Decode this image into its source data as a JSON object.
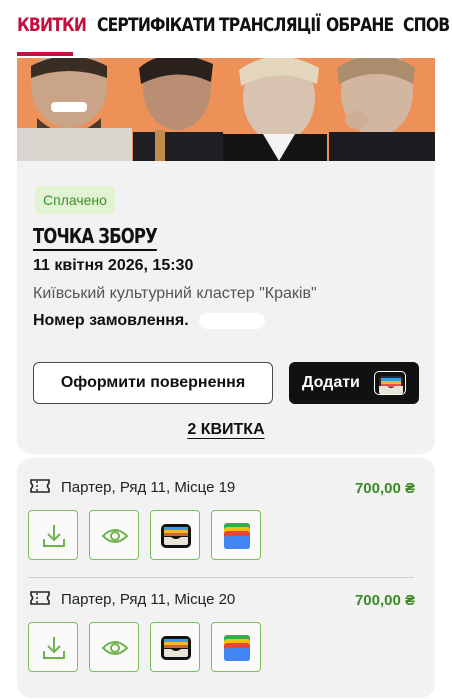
{
  "tabs": [
    {
      "label": "КВИТКИ"
    },
    {
      "label": "СЕРТИФІКАТИ"
    },
    {
      "label": "ТРАНСЛЯЦІЇ"
    },
    {
      "label": "ОБРАНЕ"
    },
    {
      "label": "СПОВ"
    }
  ],
  "active_tab": 0,
  "event": {
    "status": "Сплачено",
    "title": "ТОЧКА ЗБОРУ",
    "date": "11 квітня 2026, 15:30",
    "venue": "Київський культурний кластер \"Краків\"",
    "order_label": "Номер замовлення."
  },
  "buttons": {
    "return_label": "Оформити повернення",
    "add_label": "Додати"
  },
  "tickets_count": "2 КВИТКА",
  "tickets": [
    {
      "seat": "Партер, Ряд 11, Місце 19",
      "price": "700,00 ₴"
    },
    {
      "seat": "Партер, Ряд 11, Місце 20",
      "price": "700,00 ₴"
    }
  ],
  "colors": {
    "accent": "#c2113e",
    "status_bg": "#e1f3d3",
    "status_text": "#3e8f29",
    "price": "#3b8a26",
    "action_border": "#7cbe5e",
    "banner_bg": "#eb8a52"
  },
  "icons": {
    "ticket": "ticket-icon",
    "actions": [
      "download-icon",
      "eye-icon",
      "apple-wallet-icon",
      "google-wallet-icon"
    ]
  }
}
